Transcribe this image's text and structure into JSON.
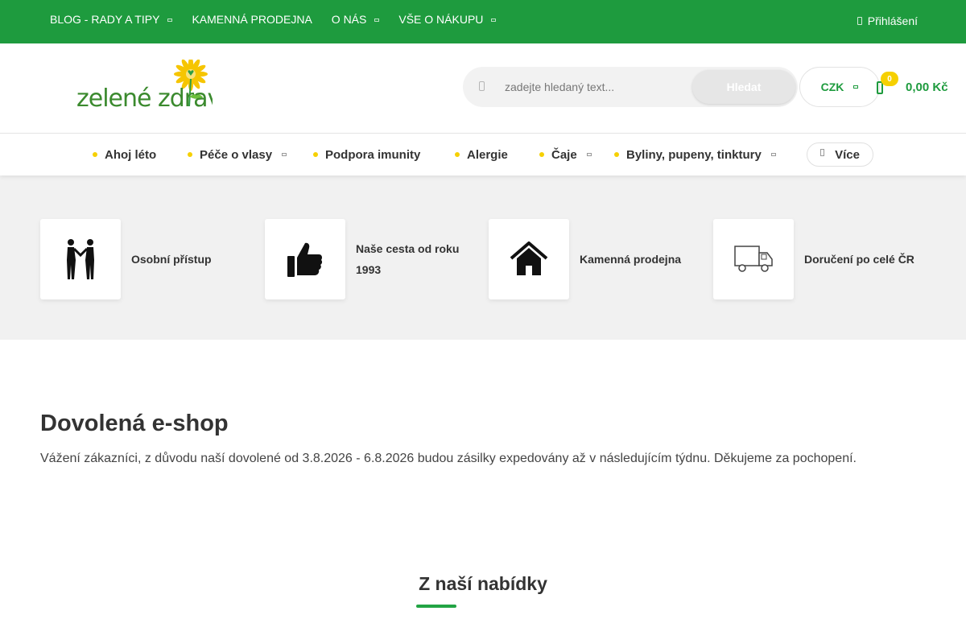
{
  "top_nav": {
    "items": [
      {
        "label": "BLOG - RADY A TIPY",
        "has_dropdown": true
      },
      {
        "label": "KAMENNÁ PRODEJNA",
        "has_dropdown": false
      },
      {
        "label": "O NÁS",
        "has_dropdown": true
      },
      {
        "label": "VŠE O NÁKUPU",
        "has_dropdown": true
      }
    ],
    "login_label": "Přihlášení"
  },
  "header": {
    "logo_text": "zelené zdraví",
    "search": {
      "placeholder": "zadejte hledaný text...",
      "value": "",
      "button_label": "Hledat"
    },
    "currency": "CZK",
    "cart": {
      "count": "0",
      "total": "0,00 Kč"
    }
  },
  "category_nav": {
    "items": [
      {
        "label": "Ahoj léto",
        "has_dropdown": false
      },
      {
        "label": "Péče o vlasy",
        "has_dropdown": true
      },
      {
        "label": "Podpora imunity",
        "has_dropdown": false
      },
      {
        "label": "Alergie",
        "has_dropdown": false
      },
      {
        "label": "Čaje",
        "has_dropdown": true
      },
      {
        "label": "Byliny, pupeny, tinktury",
        "has_dropdown": true
      }
    ],
    "more_label": "Více"
  },
  "benefits": [
    {
      "icon": "handshake-icon",
      "label": "Osobní přístup"
    },
    {
      "icon": "thumbs-up-icon",
      "label": "Naše cesta od roku 1993"
    },
    {
      "icon": "house-icon",
      "label": "Kamenná prodejna"
    },
    {
      "icon": "delivery-truck-icon",
      "label": "Doručení po celé ČR"
    }
  ],
  "announcement": {
    "title": "Dovolená e-shop",
    "text": "Vážení zákazníci, z důvodu naší dovolené od 3.8.2026 - 6.8.2026 budou zásilky expedovány až v následujícím týdnu. Děkujeme za pochopení."
  },
  "offer_section": {
    "title": "Z naší nabídky"
  },
  "colors": {
    "brand_green": "#1e9b3e",
    "accent_yellow": "#f6d000",
    "band_gray": "#f1f1f1"
  }
}
